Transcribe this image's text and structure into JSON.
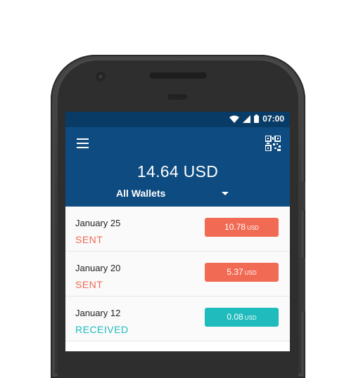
{
  "status_bar": {
    "time": "07:00"
  },
  "header": {
    "balance": "14.64 USD",
    "wallet_selector": "All Wallets"
  },
  "colors": {
    "header": "#0d4b80",
    "status_bar": "#083c66",
    "sent": "#f16a54",
    "received": "#1fbbbd"
  },
  "transactions": [
    {
      "date": "January 25",
      "type": "SENT",
      "amount": "10.78",
      "unit": "USD",
      "kind": "sent"
    },
    {
      "date": "January 20",
      "type": "SENT",
      "amount": "5.37",
      "unit": "USD",
      "kind": "sent"
    },
    {
      "date": "January 12",
      "type": "RECEIVED",
      "amount": "0.08",
      "unit": "USD",
      "kind": "received"
    }
  ],
  "icons": [
    "wifi-icon",
    "signal-icon",
    "battery-icon",
    "menu-icon",
    "qr-code-icon",
    "chevron-down-icon"
  ]
}
